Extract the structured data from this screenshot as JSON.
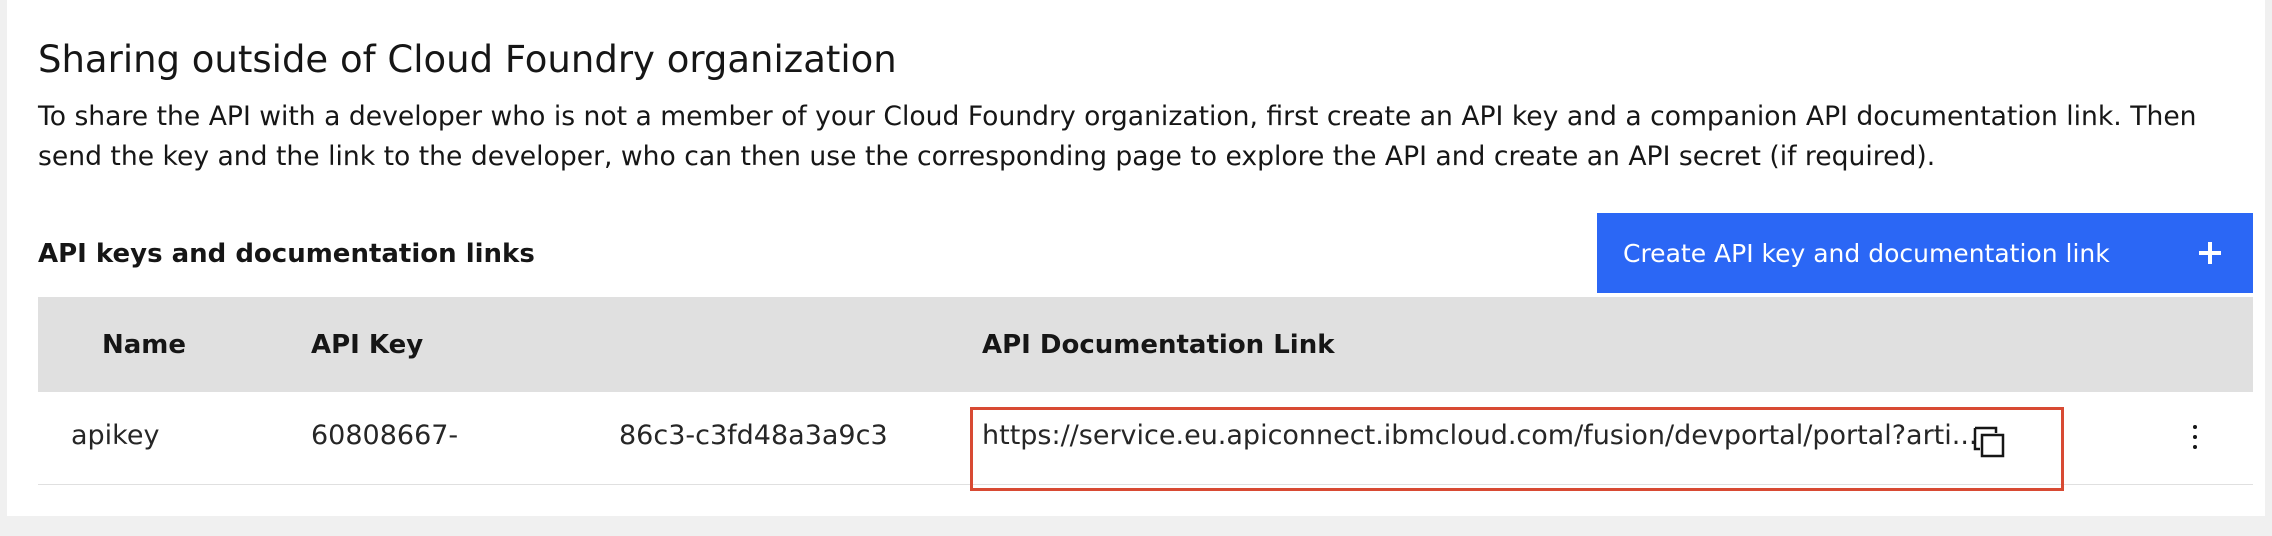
{
  "section": {
    "title": "Sharing outside of Cloud Foundry organization",
    "description": "To share the API with a developer who is not a member of your Cloud Foundry organization, first create an API key and a companion API documentation link. Then send the key and the link to the developer, who can then use the corresponding page to explore the API and create an API secret (if required).",
    "table_label": "API keys and documentation links",
    "create_button_label": "Create API key and documentation link",
    "create_button_icon": "plus-icon",
    "accent_color": "#2b67f5",
    "highlight_color": "#d84a33"
  },
  "table": {
    "headers": {
      "name": "Name",
      "api_key": "API Key",
      "documentation_link": "API Documentation Link"
    },
    "rows": [
      {
        "name": "apikey",
        "api_key_part1": "60808667-",
        "api_key_part2": "86c3-c3fd48a3a9c3",
        "documentation_link": "https://service.eu.apiconnect.ibmcloud.com/fusion/devportal/portal?arti...",
        "copy_icon": "copy-icon",
        "actions_icon": "overflow-menu-icon"
      }
    ]
  }
}
